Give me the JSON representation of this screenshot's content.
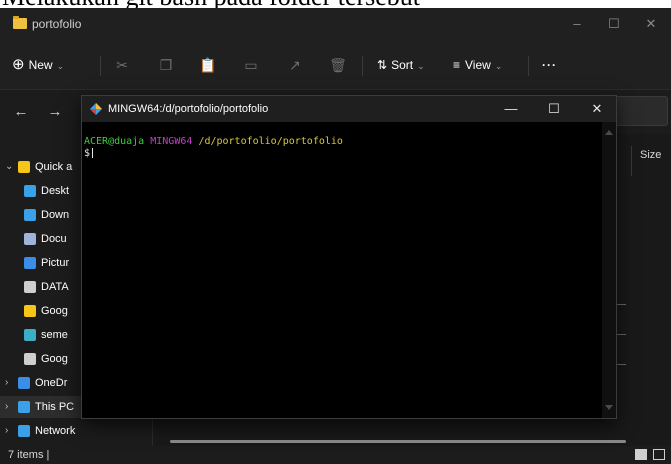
{
  "document": {
    "caption": "Melakukan git bash pada folder tersebut"
  },
  "explorer": {
    "title": "portofolio",
    "window_controls": {
      "minimize": "–",
      "maximize": "☐",
      "close": "✕"
    },
    "toolbar": {
      "new_label": "New",
      "sort_label": "Sort",
      "view_label": "View",
      "more_label": "···"
    },
    "sidebar": {
      "items": [
        {
          "label": "Quick a",
          "icon": "star-icon",
          "color": "#f5c518"
        },
        {
          "label": "Deskt",
          "icon": "desktop-icon",
          "color": "#3aa0e8"
        },
        {
          "label": "Down",
          "icon": "download-icon",
          "color": "#3aa0e8"
        },
        {
          "label": "Docu",
          "icon": "document-icon",
          "color": "#9fb4d8"
        },
        {
          "label": "Pictur",
          "icon": "pictures-icon",
          "color": "#3a8ee8"
        },
        {
          "label": "DATA",
          "icon": "drive-icon",
          "color": "#cfcfcf"
        },
        {
          "label": "Goog",
          "icon": "google-drive-icon",
          "color": "#f5c518"
        },
        {
          "label": "seme",
          "icon": "folder-icon",
          "color": "#3ab0c8"
        },
        {
          "label": "Goog",
          "icon": "drive-icon",
          "color": "#cfcfcf"
        },
        {
          "label": "OneDr",
          "icon": "onedrive-icon",
          "color": "#3a8ee8"
        },
        {
          "label": "This PC",
          "icon": "this-pc-icon",
          "color": "#3aa0e8"
        },
        {
          "label": "Network",
          "icon": "network-icon",
          "color": "#3aa0e8"
        }
      ]
    },
    "column_header": {
      "size": "Size"
    },
    "status": {
      "item_count": "7 items  |"
    }
  },
  "terminal": {
    "title": "MINGW64:/d/portofolio/portofolio",
    "controls": {
      "minimize": "—",
      "maximize": "☐",
      "close": "✕"
    },
    "prompt": {
      "user_host": "ACER@duaja",
      "system": "MINGW64",
      "path": "/d/portofolio/portofolio",
      "symbol": "$"
    }
  },
  "colors": {
    "explorer_bg": "#1c1c1c",
    "terminal_bg": "#000000",
    "prompt_user": "#3fcd3f",
    "prompt_system": "#c040c0",
    "prompt_path": "#d8c83a"
  }
}
